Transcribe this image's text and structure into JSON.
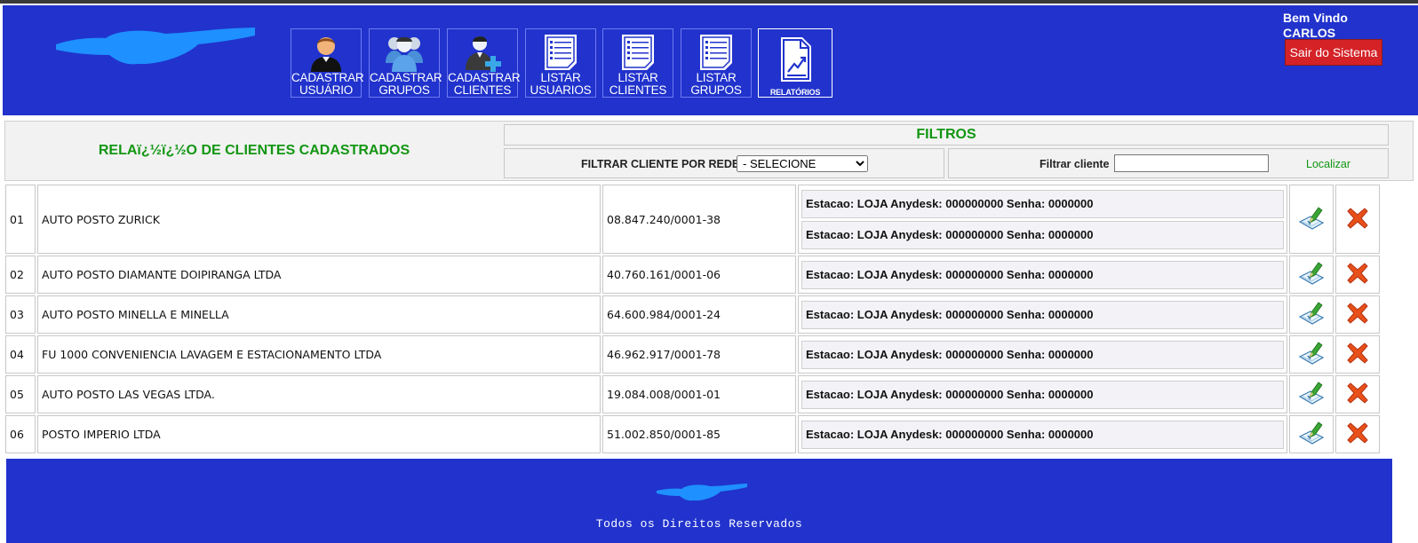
{
  "header": {
    "nav": [
      {
        "label": "CADASTRAR\nUSUÁRIO",
        "icon": "user-icon"
      },
      {
        "label": "CADASTRAR\nGRUPOS",
        "icon": "group-icon"
      },
      {
        "label": "CADASTRAR\nCLIENTES",
        "icon": "add-client-icon"
      },
      {
        "label": "LISTAR\nUSUARIOS",
        "icon": "list-icon"
      },
      {
        "label": "LISTAR\nCLIENTES",
        "icon": "list-icon"
      },
      {
        "label": "LISTAR\nGRUPOS",
        "icon": "list-icon"
      },
      {
        "label": "RELATÓRIOS",
        "icon": "report-icon"
      }
    ],
    "welcome_line": "Bem Vindo",
    "user_name": "CARLOS",
    "logout_label": "Sair do Sistema"
  },
  "report": {
    "title": "RELAï¿½ï¿½O DE CLIENTES CADASTRADOS",
    "filters_title": "FILTROS",
    "filter_network_label": "FILTRAR CLIENTE POR REDE",
    "filter_network_selected": "- SELECIONE",
    "filter_client_label": "Filtrar cliente",
    "filter_client_value": "",
    "locate_label": "Localizar"
  },
  "clients": [
    {
      "num": "01",
      "name": "AUTO POSTO ZURICK",
      "cnpj": "08.847.240/0001-38",
      "stations": [
        "Estacao: LOJA Anydesk: 000000000 Senha: 0000000",
        "Estacao: LOJA Anydesk: 000000000 Senha: 0000000"
      ]
    },
    {
      "num": "02",
      "name": "AUTO POSTO DIAMANTE DOIPIRANGA LTDA",
      "cnpj": "40.760.161/0001-06",
      "stations": [
        "Estacao: LOJA Anydesk: 000000000 Senha: 0000000"
      ]
    },
    {
      "num": "03",
      "name": "AUTO POSTO MINELLA E MINELLA",
      "cnpj": "64.600.984/0001-24",
      "stations": [
        "Estacao: LOJA Anydesk: 000000000 Senha: 0000000"
      ]
    },
    {
      "num": "04",
      "name": "FU 1000 CONVENIENCIA LAVAGEM E ESTACIONAMENTO LTDA",
      "cnpj": "46.962.917/0001-78",
      "stations": [
        "Estacao: LOJA Anydesk: 000000000 Senha: 0000000"
      ]
    },
    {
      "num": "05",
      "name": "AUTO POSTO LAS VEGAS LTDA.",
      "cnpj": "19.084.008/0001-01",
      "stations": [
        "Estacao: LOJA Anydesk: 000000000 Senha: 0000000"
      ]
    },
    {
      "num": "06",
      "name": "POSTO IMPERIO LTDA",
      "cnpj": "51.002.850/0001-85",
      "stations": [
        "Estacao: LOJA Anydesk: 000000000 Senha: 0000000"
      ]
    }
  ],
  "footer": {
    "text": "Todos os Direitos Reservados"
  },
  "colors": {
    "header_bg": "#2133cc",
    "title_green": "#129612",
    "logout_red": "#d42227",
    "logo_blue": "#1e90ff"
  }
}
